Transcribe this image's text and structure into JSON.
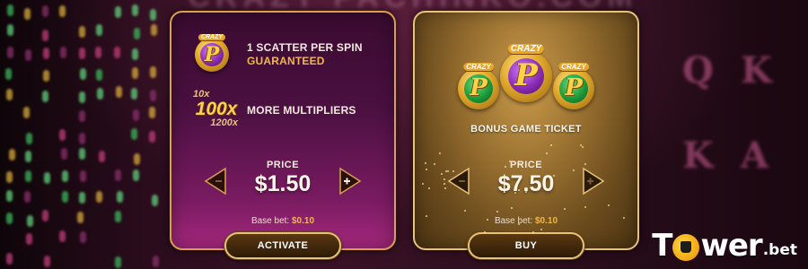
{
  "background": {
    "top_blur_text": "CRAZY PACHINKO.COM",
    "reel_letters": [
      "Q",
      "K",
      "K",
      "A"
    ]
  },
  "offer_left": {
    "feature1": {
      "line1": "1 SCATTER PER SPIN",
      "line2": "GUARANTEED"
    },
    "feature2": {
      "label": "MORE MULTIPLIERS",
      "mult_top": "10x",
      "mult_mid": "100x",
      "mult_bottom": "1200x"
    },
    "price_label": "PRICE",
    "price_value": "$1.50",
    "base_bet_label": "Base bet:",
    "base_bet_value": "$0.10",
    "button_label": "ACTIVATE"
  },
  "offer_right": {
    "title": "BONUS GAME TICKET",
    "price_label": "PRICE",
    "price_value": "$7.50",
    "base_bet_label": "Base bet:",
    "base_bet_value": "$0.10",
    "button_label": "BUY"
  },
  "coin_label": "CRAZY",
  "coin_letter": "P",
  "logo": {
    "main": "Tower",
    "suffix": ".bet"
  },
  "colors": {
    "left_card": "#4a1040",
    "right_card": "#9c7332",
    "gold_border": "#e7c27a",
    "accent_orange": "#f0b84a"
  }
}
